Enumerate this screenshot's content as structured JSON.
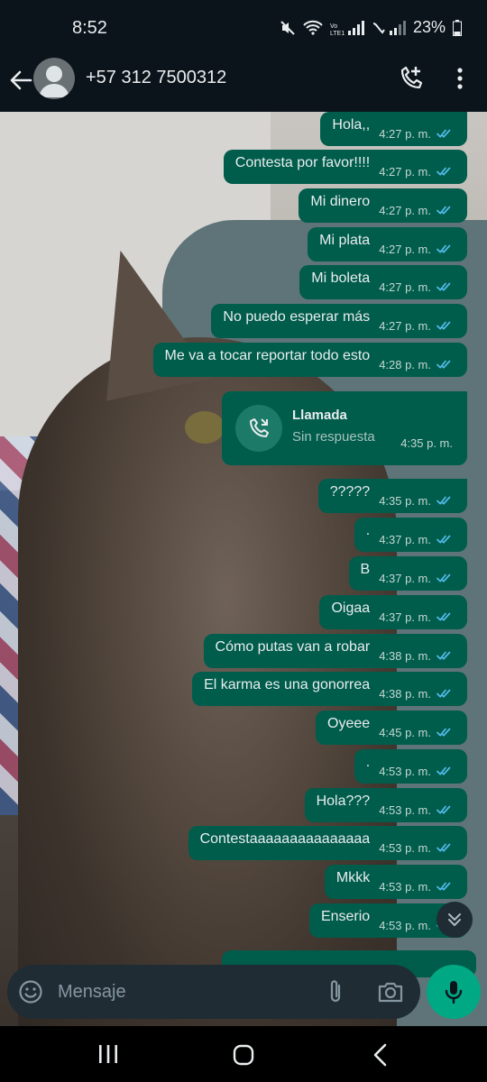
{
  "status_bar": {
    "time": "8:52",
    "battery": "23%"
  },
  "header": {
    "contact": "+57 312 7500312"
  },
  "messages": [
    {
      "text": "Hola,,",
      "time": "4:27 p. m."
    },
    {
      "text": "Contesta por favor!!!!",
      "time": "4:27 p. m."
    },
    {
      "text": "Mi dinero",
      "time": "4:27 p. m."
    },
    {
      "text": "Mi plata",
      "time": "4:27 p. m."
    },
    {
      "text": "Mi boleta",
      "time": "4:27 p. m."
    },
    {
      "text": "No puedo esperar más",
      "time": "4:27 p. m."
    },
    {
      "text": "Me va a tocar reportar todo esto",
      "time": "4:28 p. m."
    },
    {
      "text": "?????",
      "time": "4:35 p. m."
    },
    {
      "text": ".",
      "time": "4:37 p. m."
    },
    {
      "text": "B",
      "time": "4:37 p. m."
    },
    {
      "text": "Oigaa",
      "time": "4:37 p. m."
    },
    {
      "text": "Cómo putas van a robar",
      "time": "4:38 p. m."
    },
    {
      "text": "El karma es una gonorrea",
      "time": "4:38 p. m."
    },
    {
      "text": "Oyeee",
      "time": "4:45 p. m."
    },
    {
      "text": ".",
      "time": "4:53 p. m."
    },
    {
      "text": "Hola???",
      "time": "4:53 p. m."
    },
    {
      "text": "Contestaaaaaaaaaaaaaaa",
      "time": "4:53 p. m."
    },
    {
      "text": "Mkkk",
      "time": "4:53 p. m."
    },
    {
      "text": "Enserio",
      "time": "4:53 p. m."
    }
  ],
  "call": {
    "title": "Llamada",
    "status": "Sin respuesta",
    "time": "4:35 p. m."
  },
  "input": {
    "placeholder": "Mensaje"
  },
  "colors": {
    "bubble": "#005c4b",
    "read_ticks": "#53bdeb",
    "mic_button": "#00a884",
    "background": "#0b141a"
  },
  "icons": [
    "back-arrow-icon",
    "add-call-icon",
    "menu-dots-icon",
    "missed-call-icon",
    "scroll-down-icon",
    "emoji-icon",
    "attach-icon",
    "camera-icon",
    "mic-icon"
  ]
}
